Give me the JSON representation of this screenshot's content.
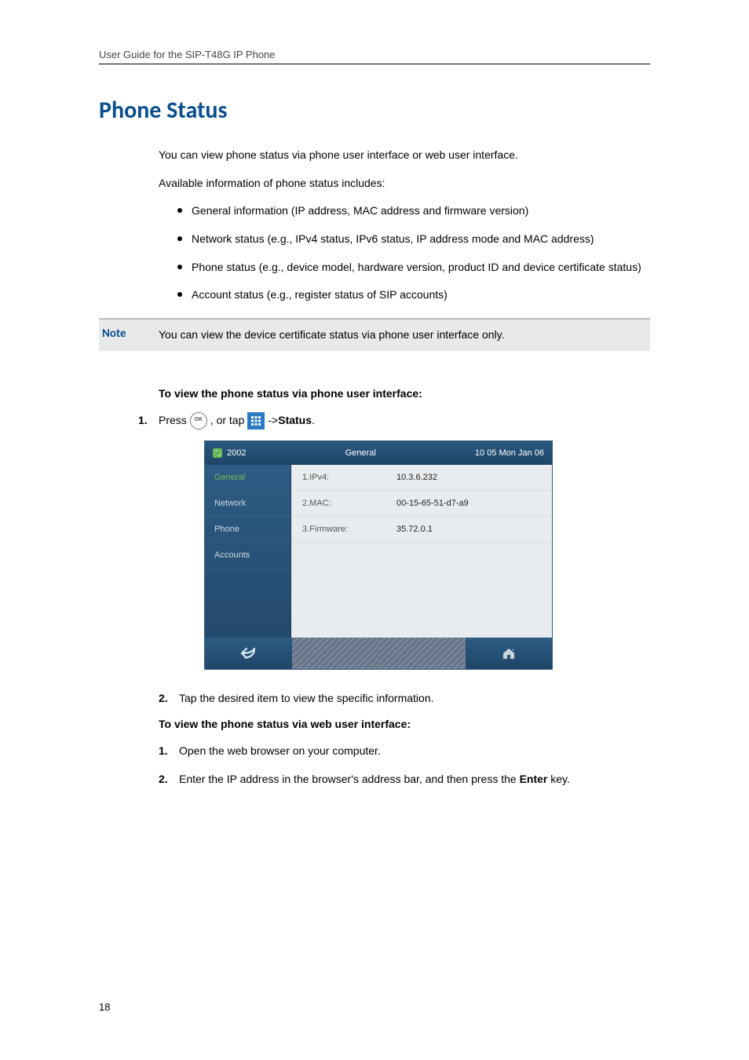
{
  "running_head": "User Guide for the SIP-T48G IP Phone",
  "title": "Phone Status",
  "intro": {
    "p1": "You can view phone status via phone user interface or web user interface.",
    "p2": "Available information of phone status includes:"
  },
  "bullets": [
    "General information (IP address, MAC address and firmware version)",
    "Network status (e.g., IPv4 status, IPv6 status, IP address mode and MAC address)",
    "Phone status (e.g., device model, hardware version, product ID and device certificate status)",
    "Account status (e.g., register status of SIP accounts)"
  ],
  "note": {
    "label": "Note",
    "text": "You can view the device certificate status via phone user interface only."
  },
  "procedure1": {
    "heading": "To view the phone status via phone user interface:",
    "step1_prefix": "Press ",
    "step1_ok": "OK",
    "step1_mid": " , or tap ",
    "step1_suffix_arrow": " ->",
    "step1_suffix_status": "Status",
    "step1_suffix_period": ".",
    "step2": "Tap the desired item to view the specific information."
  },
  "procedure2": {
    "heading": "To view the phone status via web user interface:",
    "step1": "Open the web browser on your computer.",
    "step2_pre": "Enter the IP address in the browser's address bar, and then press the ",
    "step2_key": "Enter",
    "step2_post": " key."
  },
  "phone_screen": {
    "top": {
      "ext": "2002",
      "center": "General",
      "time": "10 05 Mon Jan 06"
    },
    "side": [
      "General",
      "Network",
      "Phone",
      "Accounts"
    ],
    "rows": [
      {
        "k": "1.IPv4:",
        "v": "10.3.6.232"
      },
      {
        "k": "2.MAC:",
        "v": "00-15-65-51-d7-a9"
      },
      {
        "k": "3.Firmware:",
        "v": "35.72.0.1"
      }
    ]
  },
  "page_number": "18",
  "step_labels": {
    "s1": "1.",
    "s2": "2."
  }
}
